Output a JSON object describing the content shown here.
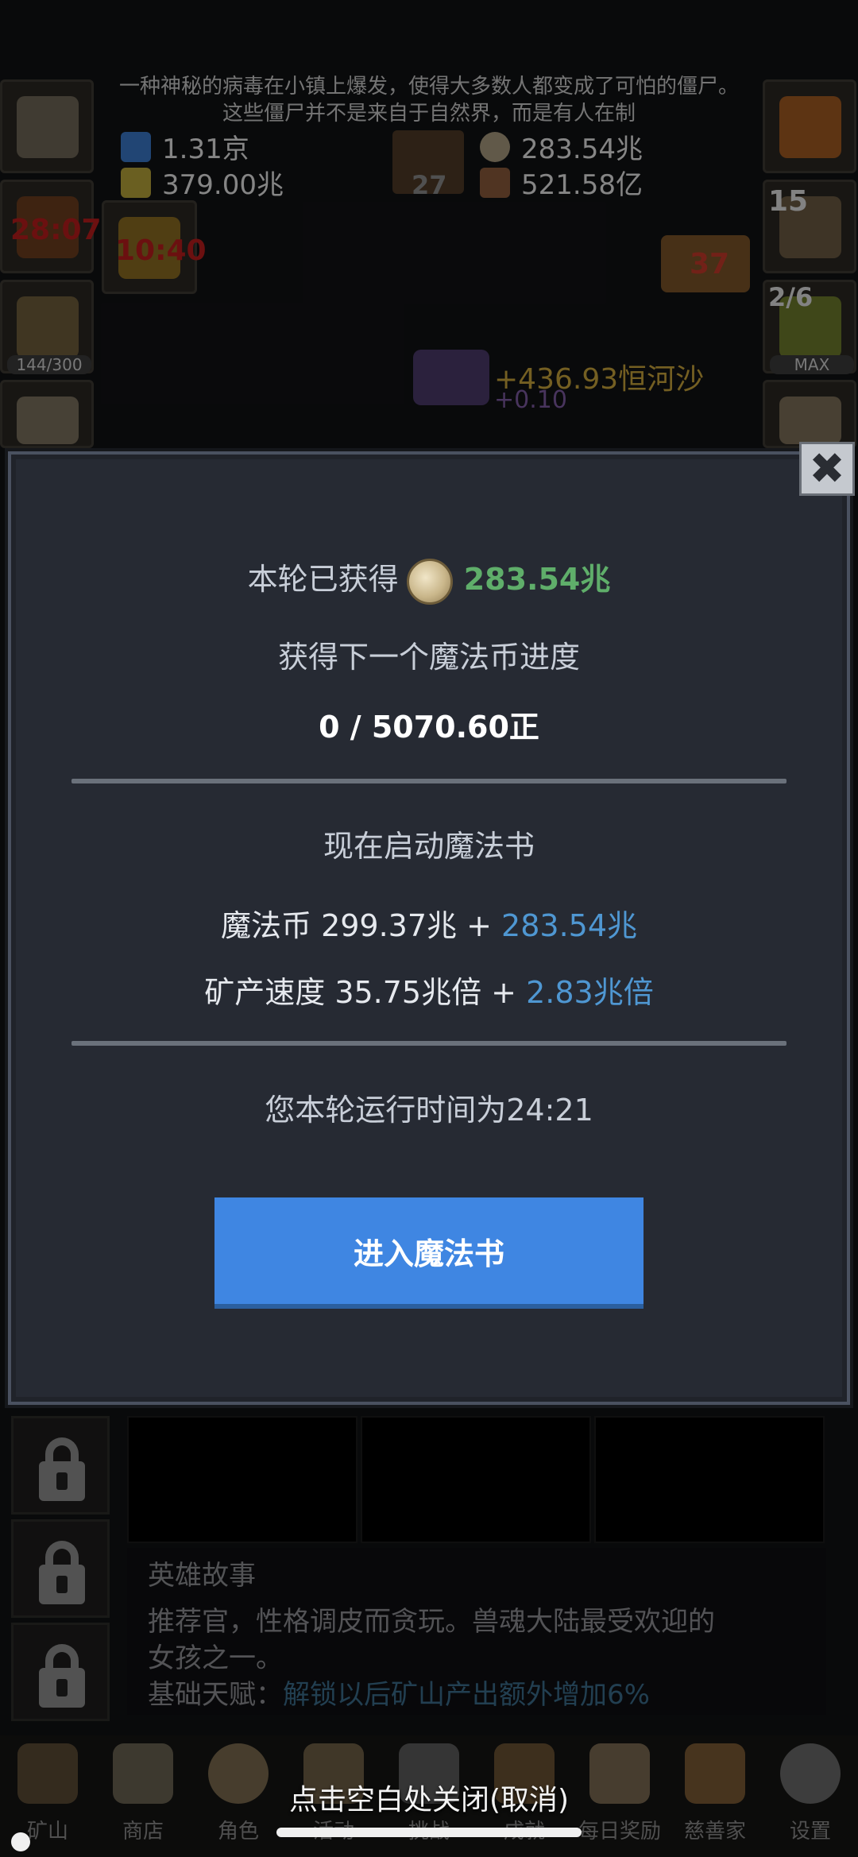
{
  "background": {
    "story_intro": [
      "一种神秘的病毒在小镇上爆发，使得大多数人都变成了可怕的僵尸。",
      "这些僵尸并不是来自于自然界，而是有人在制"
    ],
    "resources": [
      {
        "icon": "potion-blue-icon",
        "value": "1.31京"
      },
      {
        "icon": "potion-yellow-icon",
        "value": "379.00兆"
      },
      {
        "icon": "coin-icon",
        "value": "283.54兆"
      },
      {
        "icon": "meat-icon",
        "value": "521.58亿"
      }
    ],
    "book_count": "27",
    "timers": {
      "left": "28:07",
      "center": "10:40"
    },
    "chest_count": "37",
    "treasure_count": "15",
    "slime_count": "2/6",
    "slime_bar": "MAX",
    "beer_bar": "144/300",
    "exp_gain": "+436.93恒河沙",
    "exp_sub": "+0.10"
  },
  "modal": {
    "earned_label": "本轮已获得",
    "earned_value": "283.54兆",
    "progress_label": "获得下一个魔法币进度",
    "progress_value": "0 / 5070.60正",
    "start_label": "现在启动魔法书",
    "coin_label": "魔法币 299.37兆 +",
    "coin_plus": "283.54兆",
    "speed_label": "矿产速度 35.75兆倍 +",
    "speed_plus": "2.83兆倍",
    "runtime": "您本轮运行时间为24:21",
    "enter_button": "进入魔法书",
    "close_symbol": "✖"
  },
  "story": {
    "title": "英雄故事",
    "line1": "推荐官，性格调皮而贪玩。兽魂大陆最受欢迎的",
    "line2": "女孩之一。",
    "talent_label": "基础天赋：",
    "talent_value": "解锁以后矿山产出额外增加6%"
  },
  "nav": {
    "items": [
      {
        "label": "矿山",
        "icon": "lantern-icon"
      },
      {
        "label": "商店",
        "icon": "shop-icon"
      },
      {
        "label": "角色",
        "icon": "skull-icon"
      },
      {
        "label": "活动",
        "icon": "scroll-icon"
      },
      {
        "label": "挑战",
        "icon": "castle-icon"
      },
      {
        "label": "成就",
        "icon": "trophy-icon"
      },
      {
        "label": "每日奖励",
        "icon": "envelope-icon"
      },
      {
        "label": "慈善家",
        "icon": "bread-icon"
      },
      {
        "label": "设置",
        "icon": "gear-icon"
      }
    ],
    "close_hint": "点击空白处关闭(取消)"
  },
  "colors": {
    "accent_green": "#5fae6a",
    "accent_blue": "#4f97d2",
    "button_blue": "#3f86e2",
    "modal_bg": "#262a33"
  }
}
